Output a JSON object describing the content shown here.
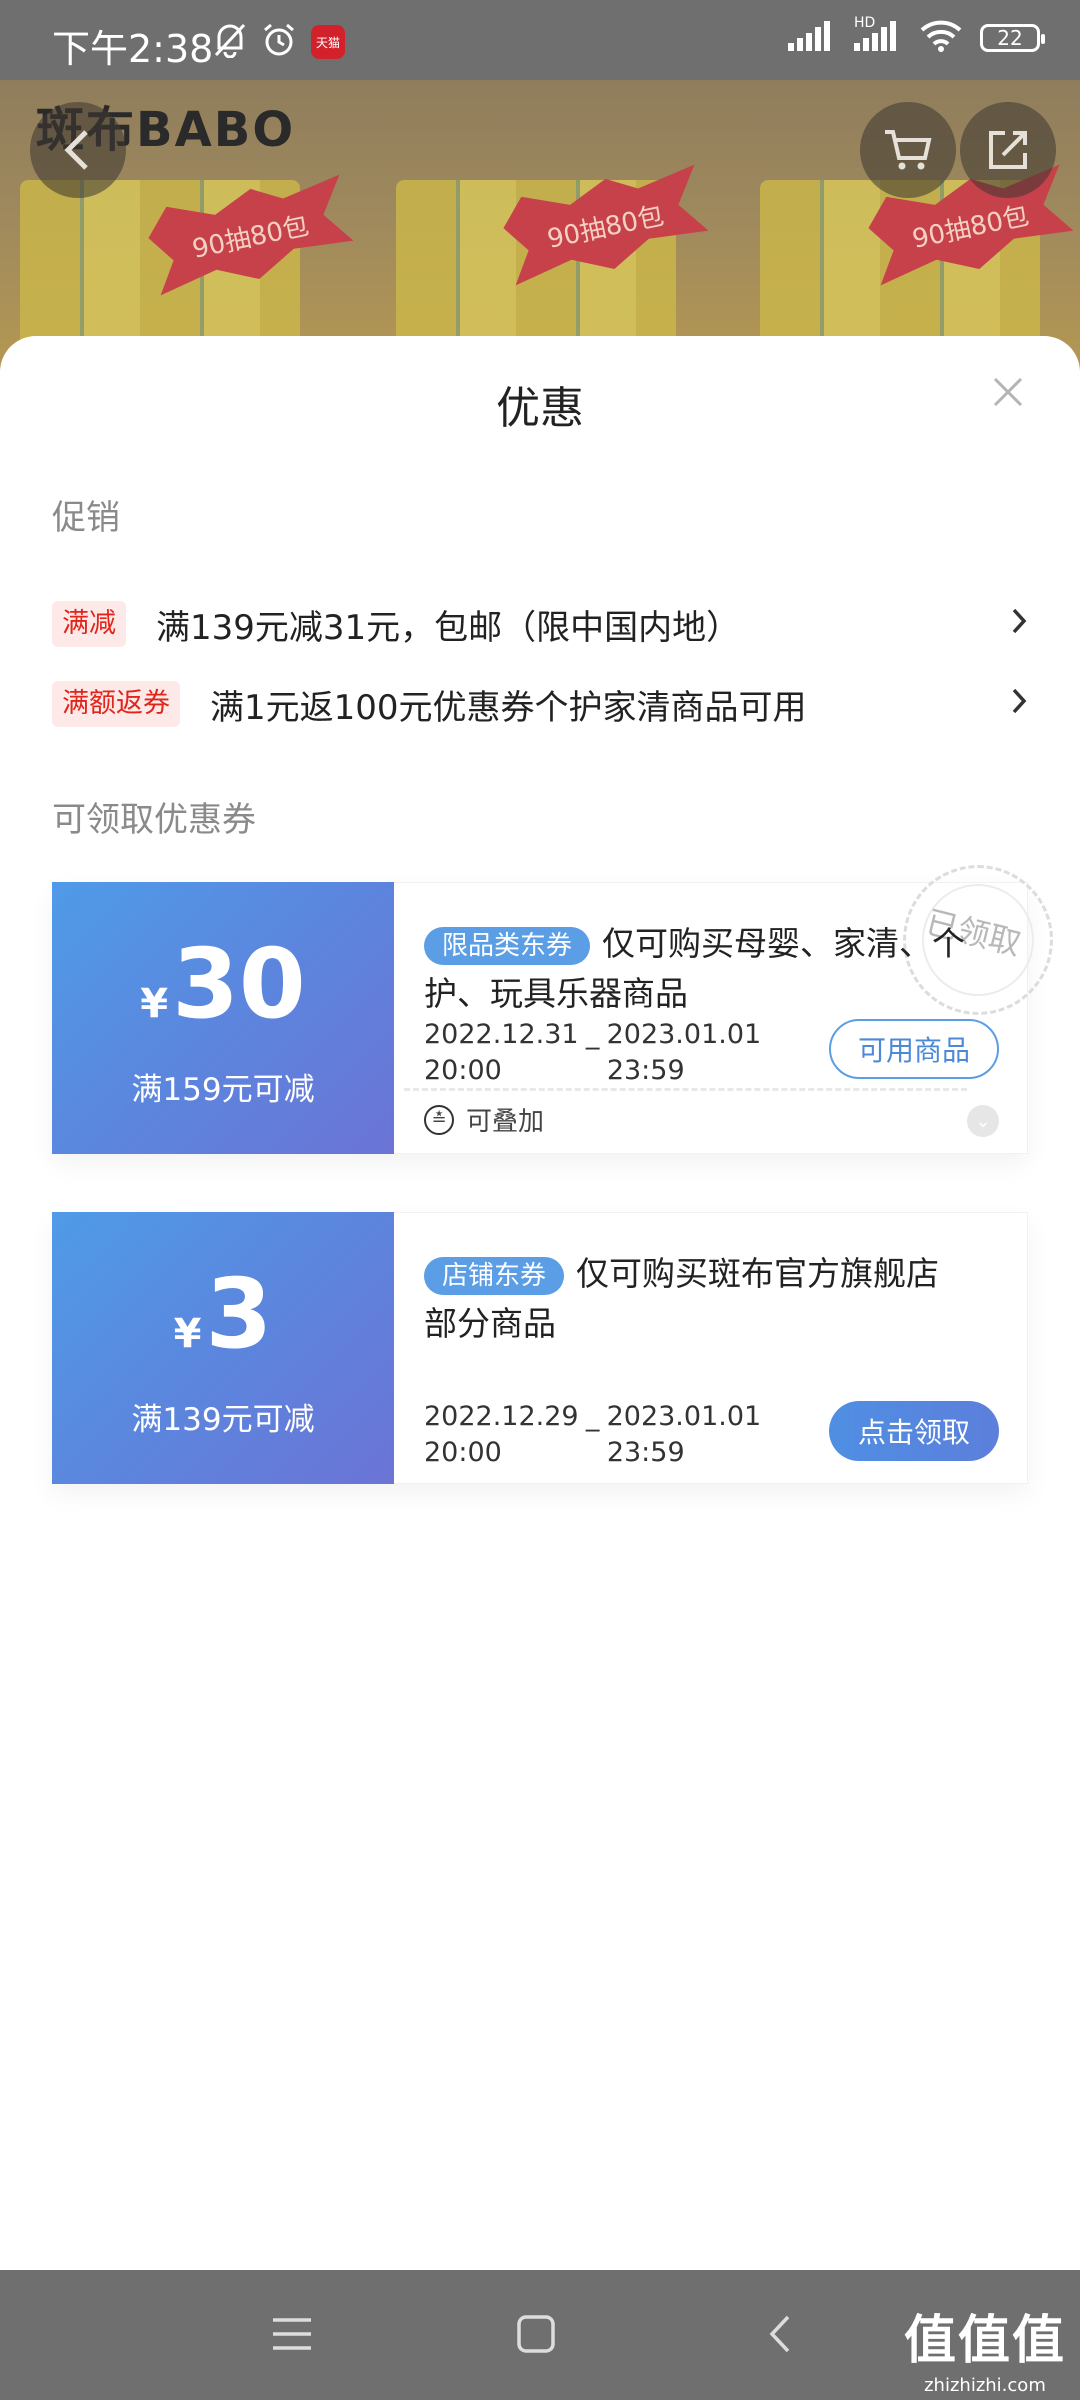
{
  "status_bar": {
    "time": "下午2:38",
    "badge_text": "天猫",
    "battery": "22",
    "network_label": "HD"
  },
  "hero": {
    "brand_logo": "斑布BABO",
    "burst_text": "90抽80包"
  },
  "sheet": {
    "title": "优惠",
    "promotions_label": "促销",
    "promotions": [
      {
        "tag": "满减",
        "text": "满139元减31元，包邮（限中国内地）"
      },
      {
        "tag": "满额返券",
        "text": "满1元返100元优惠券个护家清商品可用"
      }
    ],
    "coupons_label": "可领取优惠券",
    "coupons": [
      {
        "currency": "¥",
        "amount": "30",
        "threshold": "满159元可减",
        "tag": "限品类东券",
        "description": "仅可购买母婴、家清、个护、玩具乐器商品",
        "date_start": "2022.12.31",
        "date_end": "2023.01.01",
        "time_start": "20:00",
        "time_end": "23:59",
        "date_sep": "_",
        "button": "可用商品",
        "stackable": "可叠加",
        "stamp": "已领取"
      },
      {
        "currency": "¥",
        "amount": "3",
        "threshold": "满139元可减",
        "tag": "店铺东券",
        "description": "仅可购买斑布官方旗舰店部分商品",
        "date_start": "2022.12.29",
        "date_end": "2023.01.01",
        "time_start": "20:00",
        "time_end": "23:59",
        "date_sep": "_",
        "button": "点击领取"
      }
    ]
  },
  "watermark": {
    "title": "值值值",
    "site": "zhizhizhi.com"
  },
  "colors": {
    "accent": "#5b9ee6",
    "promo_red": "#e1251b",
    "coupon_gradient_start": "#4f9be8",
    "coupon_gradient_end": "#6c74d6"
  }
}
